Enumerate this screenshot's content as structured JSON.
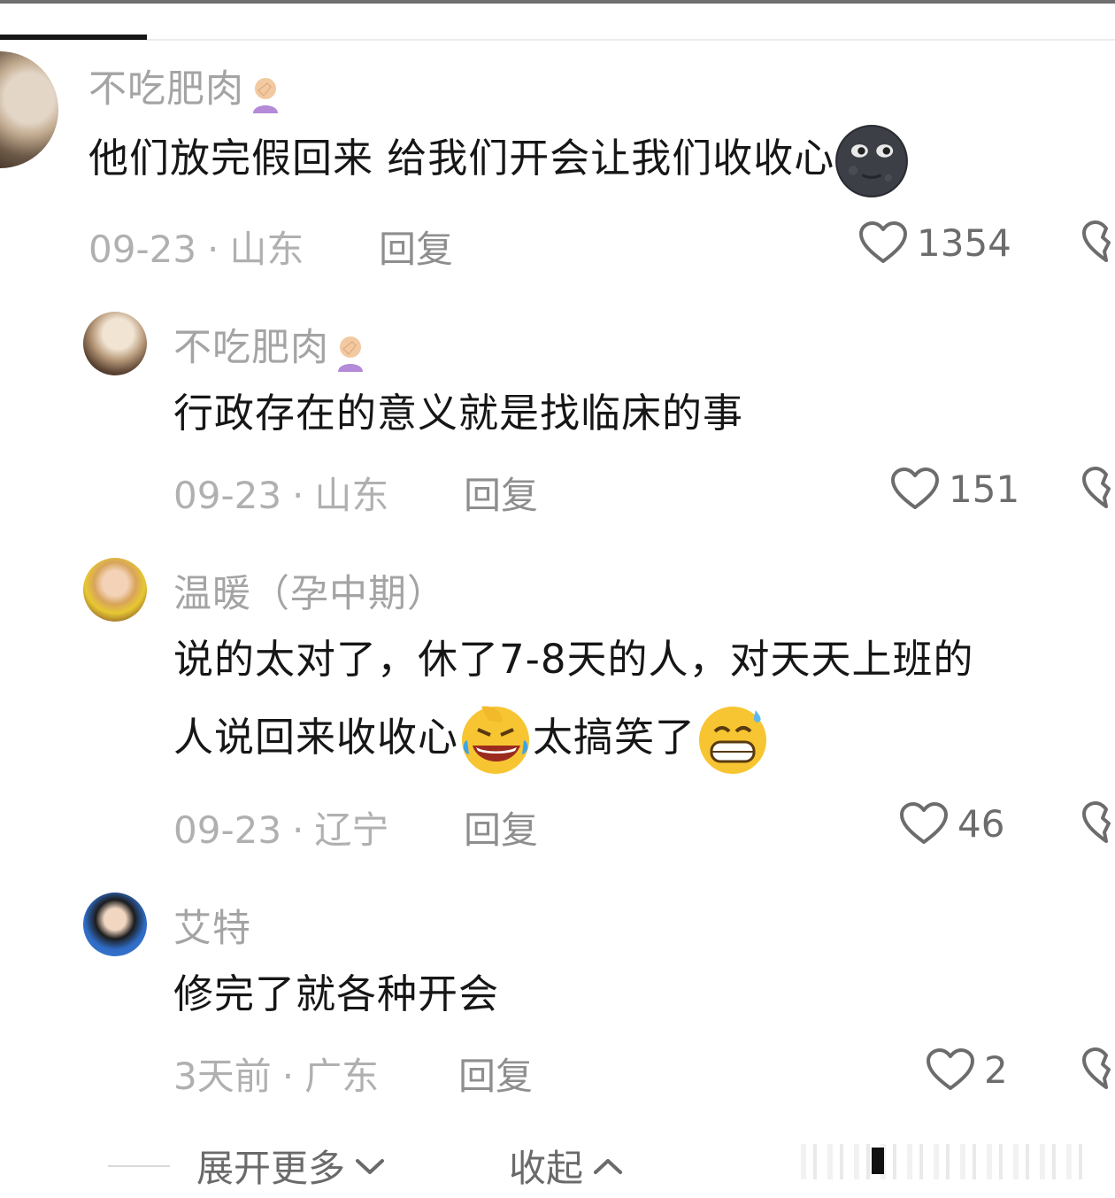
{
  "comments": [
    {
      "username": "不吃肥肉",
      "text": "他们放完假回来 给我们开会让我们收收心",
      "date": "09-23",
      "location": "山东",
      "reply_label": "回复",
      "likes": "1354",
      "username_emoji": "facepalm-emoji",
      "text_emoji": "new-moon-face-emoji"
    },
    {
      "username": "不吃肥肉",
      "text": "行政存在的意义就是找临床的事",
      "date": "09-23",
      "location": "山东",
      "reply_label": "回复",
      "likes": "151",
      "username_emoji": "facepalm-emoji"
    },
    {
      "username": "温暖（孕中期）",
      "text_line1": "说的太对了，休了7-8天的人，对天天上班的",
      "text_line2_a": "人说回来收收心",
      "text_line2_b": "太搞笑了",
      "date": "09-23",
      "location": "辽宁",
      "reply_label": "回复",
      "likes": "46",
      "text_emojis": [
        "rolling-laughing-emoji",
        "grinning-sweat-emoji"
      ]
    },
    {
      "username": "艾特",
      "text": "修完了就各种开会",
      "date": "3天前",
      "location": "广东",
      "reply_label": "回复",
      "likes": "2"
    }
  ],
  "footer": {
    "expand_label": "展开更多",
    "collapse_label": "收起"
  },
  "colors": {
    "username": "#a4a4a4",
    "text": "#161616",
    "meta": "#b0b0b0",
    "tab_indicator": "#161616"
  }
}
